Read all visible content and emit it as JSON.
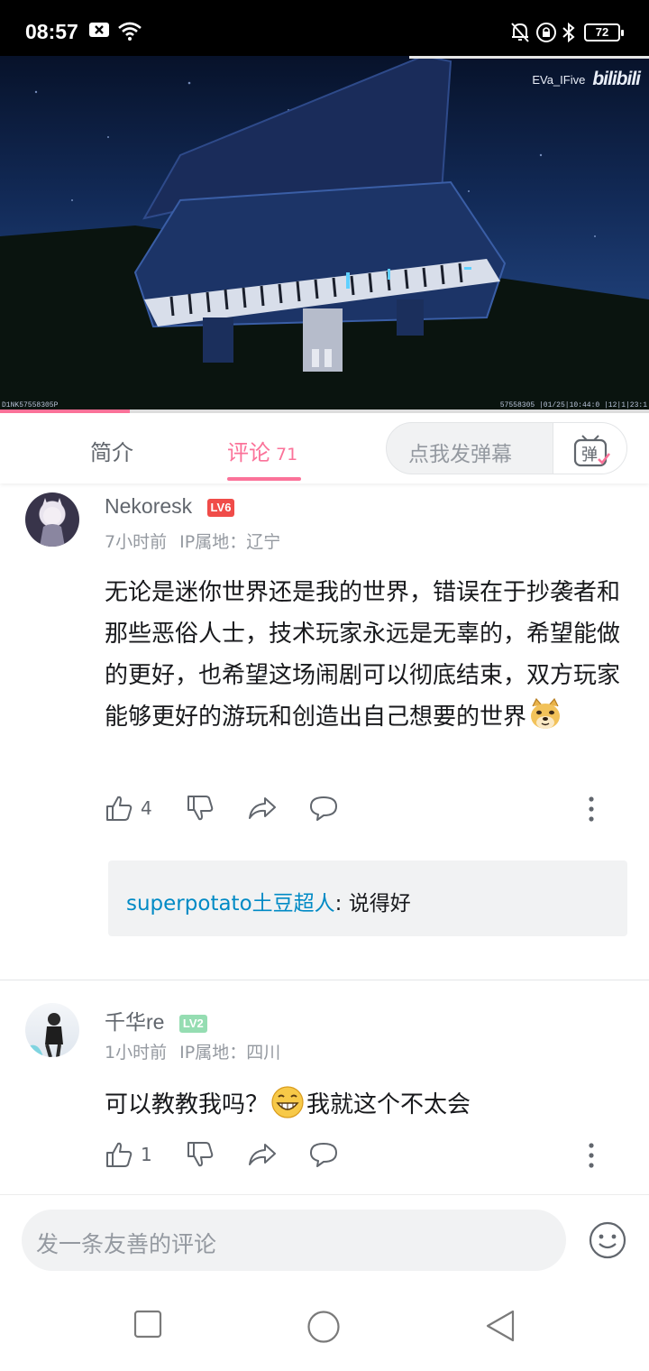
{
  "status_bar": {
    "time": "08:57",
    "battery": "72"
  },
  "video": {
    "watermark_user": "EVa_IFive",
    "watermark_logo": "bilibili",
    "overlay_left": "D1NK57558305P",
    "overlay_right": "57558305  |01/25|10:44:0  |12|1|23:1",
    "progress_fraction": 0.2
  },
  "tabs": {
    "intro_label": "简介",
    "comments_label": "评论",
    "comments_count": "71",
    "danmaku_placeholder": "点我发弹幕",
    "danmaku_button": "弹"
  },
  "comments": [
    {
      "username": "Nekoresk",
      "level": "LV6",
      "level_color": "#f04c49",
      "time": "7小时前",
      "ip": "IP属地：辽宁",
      "text": "无论是迷你世界还是我的世界，错误在于抄袭者和那些恶俗人士，技术玩家永远是无辜的，希望能做的更好，也希望这场闹剧可以彻底结束，双方玩家能够更好的游玩和创造出自己想要的世界",
      "emoji": "doge-emoji",
      "likes": "4",
      "reply": {
        "user": "superpotato土豆超人",
        "separator": ": ",
        "text": "说得好"
      }
    },
    {
      "username": "千华re",
      "level": "LV2",
      "level_color": "#95ddb2",
      "time": "1小时前",
      "ip": "IP属地：四川",
      "text_before": "可以教教我吗？",
      "emoji": "grin-emoji",
      "text_after": "我就这个不太会",
      "likes": "1"
    }
  ],
  "bottom": {
    "placeholder": "发一条友善的评论"
  },
  "colors": {
    "accent": "#fb7299",
    "link": "#008ac5"
  }
}
